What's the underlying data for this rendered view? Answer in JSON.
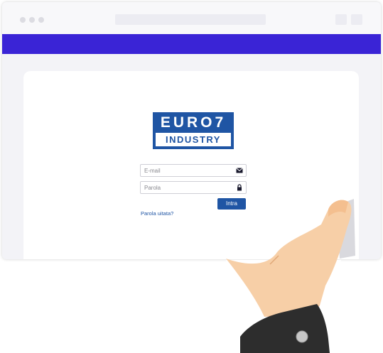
{
  "logo": {
    "line1": "EURO7",
    "line2": "INDUSTRY"
  },
  "login": {
    "email_placeholder": "E-mail",
    "password_placeholder": "Parola",
    "submit_label": "Intra",
    "forgot_label": "Parola uitata?"
  },
  "icons": {
    "email": "envelope-icon",
    "password": "lock-icon"
  },
  "colors": {
    "navbar": "#3a24d6",
    "brand": "#1f55a4"
  }
}
